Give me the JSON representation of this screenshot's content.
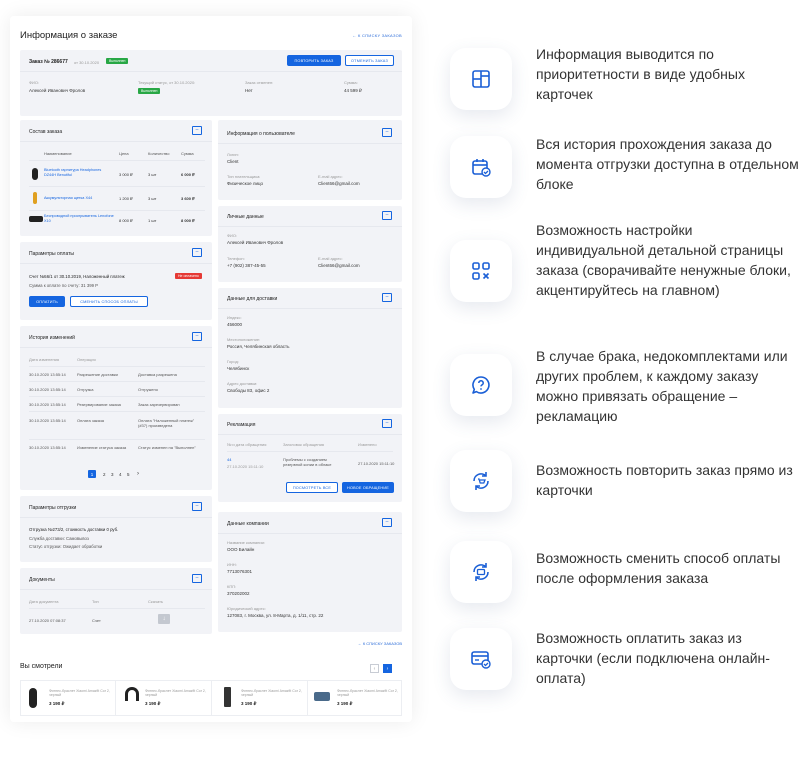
{
  "panel": {
    "title": "Информация о заказе",
    "back_to_orders": "← к списку заказов",
    "order": {
      "number": "Заказ № 286677",
      "date": "от 30.10.2020",
      "status": "Выполнен",
      "repeat_btn": "повторить заказ",
      "cancel_btn": "отменить заказ",
      "fio_label": "ФИО:",
      "fio": "Алексей Иванович Фролов",
      "status_label": "Текущий статус, от 30.10.2020:",
      "status_value": "Выполнен",
      "paid_label": "Заказ отменен:",
      "paid_value": "Нет",
      "sum_label": "Сумма:",
      "sum_value": "44 599 ₽"
    },
    "composition": {
      "title": "Состав заказа",
      "cols": [
        "Наименование",
        "Цена",
        "Количество",
        "Сумма"
      ],
      "rows": [
        {
          "name": "Bluetooth гарнитура Headphones DZ44H Benutiful",
          "price": "3 000 ₽",
          "qty": "3 шт",
          "sum": "6 000 ₽"
        },
        {
          "name": "Аккумуляторная щетка X44",
          "price": "1 200 ₽",
          "qty": "3 шт",
          "sum": "3 600 ₽"
        },
        {
          "name": "Беспроводной проигрыватель Lenofone X10",
          "price": "8 000 ₽",
          "qty": "1 шт",
          "sum": "8 000 ₽"
        }
      ]
    },
    "payment": {
      "title": "Параметры оплаты",
      "invoice": "Счет №56/1 от 30.10.2019, Наложенный платеж",
      "unpaid": "Не оплачено",
      "sum": "Сумма к оплате по счету: 31 399 Р",
      "pay_btn": "оплатить",
      "change_btn": "сменить способ оплаты"
    },
    "history": {
      "title": "История изменений",
      "cols": [
        "Дата изменения",
        "Операция",
        ""
      ],
      "rows": [
        {
          "date": "30.10.2020 13:55:14",
          "op": "Разрешение доставки",
          "val": "Доставка разрешена"
        },
        {
          "date": "30.10.2020 13:55:14",
          "op": "Отгрузка",
          "val": "Отгружено"
        },
        {
          "date": "30.10.2020 13:55:14",
          "op": "Резервирование заказа",
          "val": "Заказ зарезервирован"
        },
        {
          "date": "30.10.2020 13:55:14",
          "op": "Оплата заказа",
          "val": "Оплата \"Наложенный платеж\" (#37) произведена"
        },
        {
          "date": "30.10.2020 13:55:14",
          "op": "Изменение статуса заказа",
          "val": "Статус изменен на \"Выполнен\""
        }
      ],
      "pages": [
        "1",
        "2",
        "3",
        "4",
        "5",
        "›"
      ]
    },
    "shipment": {
      "title": "Параметры отгрузки",
      "line1": "Отгрузка №273/2, стоимость доставки 0 руб.",
      "line2": "Служба доставки: Самовывоз",
      "line3": "Статус отгрузки: Ожидает обработки"
    },
    "documents": {
      "title": "Документы",
      "cols": [
        "Дата документа",
        "Тип",
        "Скачать"
      ],
      "row": {
        "date": "27.10.2020 07:08:37",
        "type": "Счет"
      }
    },
    "user": {
      "title": "Информация о пользователе",
      "login_label": "Логин:",
      "login": "Client",
      "type_label": "Тип плательщика:",
      "type": "Физическое лицо",
      "email_label": "E-mail адрес:",
      "email": "Client66@gmail.com"
    },
    "personal": {
      "title": "Личные данные",
      "fio_label": "ФИО:",
      "fio": "Алексей Иванович Фролов",
      "phone_label": "Телефон:",
      "phone": "+7 (902) 387-45-55",
      "email_label": "E-mail адрес:",
      "email": "Client66@gmail.com"
    },
    "delivery": {
      "title": "Данные для доставки",
      "index_label": "Индекс:",
      "index": "456000",
      "loc_label": "Местоположение:",
      "loc": "Россия, Челябинская область",
      "city_label": "Город:",
      "city": "Челябинск",
      "addr_label": "Адрес доставки:",
      "addr": "Свободы 83, офис 2"
    },
    "claim": {
      "title": "Рекламация",
      "cols": [
        "№ и дата обращения",
        "Заголовок обращения",
        "Изменено"
      ],
      "num": "44",
      "num_date": "27.10.2020 15:11:10",
      "subject": "Проблемы с созданием резервной копии в облаке",
      "changed": "27.10.2020 15:11:10",
      "show_all": "посмотреть все",
      "new_btn": "новое обращение"
    },
    "company": {
      "title": "Данные компании",
      "name_label": "Название компании:",
      "name": "ООО Билайн",
      "inn_label": "ИНН:",
      "inn": "7713076301",
      "kpp_label": "КПП:",
      "kpp": "370202002",
      "addr_label": "Юридический адрес:",
      "addr": "127083, г. Москва, ул. 8-Марта, д. 1/11, стр. 22"
    },
    "back_bottom": "← к списку заказов",
    "viewed": {
      "title": "Вы смотрели",
      "items": [
        {
          "name": "Фитнес-браслет Xiaomi Amazfit Cor 2, черный",
          "price": "3 190 ₽"
        },
        {
          "name": "Фитнес-браслет Xiaomi Amazfit Cor 2, черный",
          "price": "3 190 ₽"
        },
        {
          "name": "Фитнес-браслет Xiaomi Amazfit Cor 2, черный",
          "price": "3 190 ₽"
        },
        {
          "name": "Фитнес-браслет Xiaomi Amazfit Cor 2, черный",
          "price": "3 190 ₽"
        }
      ]
    }
  },
  "features": [
    {
      "icon": "layout-grid-icon",
      "text": "Информация выводится по приоритетности в виде удобных карточек"
    },
    {
      "icon": "calendar-check-icon",
      "text": "Вся история прохождения заказа до момента отгрузки доступна в отдельном блоке"
    },
    {
      "icon": "blocks-close-icon",
      "text": "Возможность настройки индивидуальной детальной страницы заказа (сворачивайте ненужные блоки, акцентируйтесь на главном)"
    },
    {
      "icon": "question-bubble-icon",
      "text": "В случае брака, недокомплектами или других проблем, к каждому заказу можно привязать обращение – рекламацию"
    },
    {
      "icon": "cart-repeat-icon",
      "text": "Возможность повторить заказ прямо из карточки"
    },
    {
      "icon": "payment-change-icon",
      "text": "Возможность сменить способ оплаты после оформления заказа"
    },
    {
      "icon": "card-pay-icon",
      "text": "Возможность оплатить заказ из карточки (если подключена онлайн-оплата)"
    }
  ],
  "colors": {
    "accent": "#1565e0",
    "success": "#28a745",
    "danger": "#e53935",
    "icon": "#1a5fd6"
  }
}
